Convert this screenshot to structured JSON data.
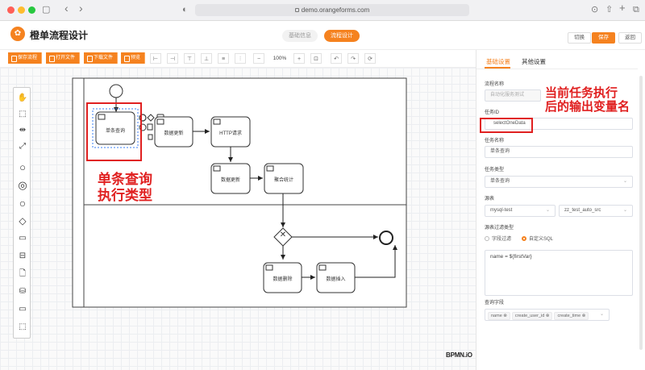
{
  "browser": {
    "url": "demo.orangeforms.com",
    "back_glyph": "‹",
    "forward_glyph": "›",
    "sidebar_glyph": "▢",
    "shield_glyph": "◐",
    "download_glyph": "⊙",
    "share_glyph": "⇧",
    "newtab_glyph": "+",
    "tabs_glyph": "⧉"
  },
  "header": {
    "logo_glyph": "✿",
    "title": "橙单流程设计",
    "steps": [
      "基础信息",
      "流程设计"
    ],
    "buttons": {
      "switch": "切换",
      "save": "保存",
      "back": "返回"
    }
  },
  "toolbar": {
    "buttons": [
      "保存流程",
      "打开文件",
      "下载文件",
      "预览"
    ],
    "zoom": "100%"
  },
  "diagram": {
    "tasks": {
      "single_query": "单条查询",
      "update1": "数据更新",
      "http": "HTTP请求",
      "update2": "数据更新",
      "aggregate": "聚合统计",
      "delete": "数据删除",
      "insert": "数据插入"
    },
    "gateway_glyph": "✕",
    "watermark": "BPMN.iO"
  },
  "panel": {
    "tabs": {
      "basic": "基础设置",
      "other": "其他设置"
    },
    "flow_name_label": "流程名称",
    "flow_name_value": "自动化服务测试",
    "task_id_label": "任务ID",
    "task_id_value": "selectOneData",
    "task_name_label": "任务名称",
    "task_name_value": "单条查询",
    "task_type_label": "任务类型",
    "task_type_value": "单条查询",
    "source_table_label": "源表",
    "source_value": "mysql-test",
    "table_value": "zz_test_auto_src",
    "filter_type_label": "源表过滤类型",
    "filter_options": [
      "字段过滤",
      "自定义SQL"
    ],
    "sql_value": "name = ${firstVar}",
    "query_fields_label": "查询字段",
    "query_fields": [
      "name",
      "create_user_id",
      "create_time"
    ]
  },
  "annotations": {
    "left_line1": "单条查询",
    "left_line2": "执行类型",
    "right_line1": "当前任务执行",
    "right_line2": "后的输出变量名"
  }
}
